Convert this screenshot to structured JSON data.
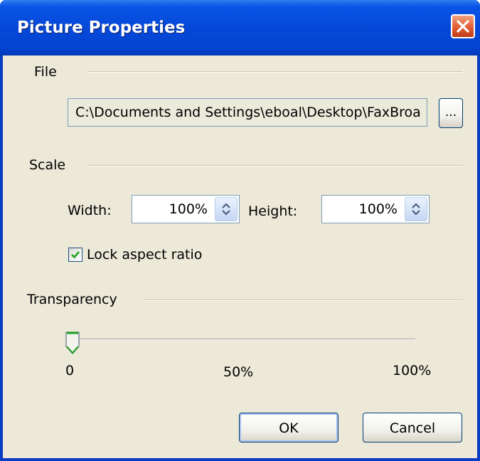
{
  "window": {
    "title": "Picture Properties"
  },
  "file": {
    "section_label": "File",
    "path_value": "C:\\Documents and Settings\\eboal\\Desktop\\FaxBroa",
    "browse_label": "..."
  },
  "scale": {
    "section_label": "Scale",
    "width_label": "Width:",
    "width_value": "100%",
    "height_label": "Height:",
    "height_value": "100%",
    "lock_label": "Lock aspect ratio",
    "lock_checked": true
  },
  "transparency": {
    "section_label": "Transparency",
    "value_fraction": 0,
    "tick_labels": [
      "0",
      "50%",
      "100%"
    ]
  },
  "buttons": {
    "ok": "OK",
    "cancel": "Cancel"
  },
  "icons": {
    "close": "close-icon",
    "spin_width": "spin-arrows-icon",
    "spin_height": "spin-arrows-icon",
    "check": "check-icon",
    "slider_thumb": "slider-thumb-icon"
  },
  "colors": {
    "titlebar": "#0548d8",
    "dialog_face": "#ece9d8",
    "close_button": "#e15d33",
    "checkmark": "#21a121",
    "slider_thumb_accent": "#21a121"
  }
}
